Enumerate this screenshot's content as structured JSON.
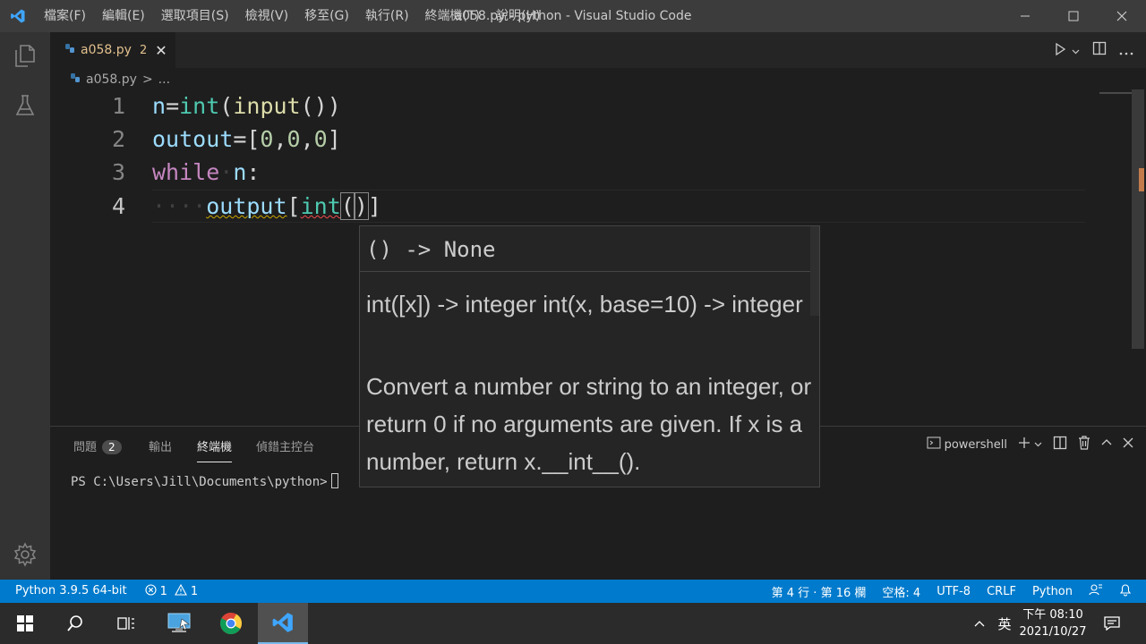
{
  "window": {
    "title": "a058.py - python - Visual Studio Code",
    "menu": [
      "檔案(F)",
      "編輯(E)",
      "選取項目(S)",
      "檢視(V)",
      "移至(G)",
      "執行(R)",
      "終端機(T)",
      "說明(H)"
    ]
  },
  "tab": {
    "filename": "a058.py",
    "problem_count": "2"
  },
  "breadcrumb": {
    "file": "a058.py",
    "sep": ">",
    "rest": "..."
  },
  "editor": {
    "line_numbers": [
      "1",
      "2",
      "3",
      "4"
    ],
    "line1": {
      "n": "n",
      "eq": "=",
      "int": "int",
      "p1": "(",
      "input": "input",
      "p2": "())"
    },
    "line2": {
      "var": "outout",
      "eq": "=[",
      "a": "0",
      "c1": ",",
      "b": "0",
      "c2": ",",
      "c": "0",
      "end": "]"
    },
    "line3": {
      "kw": "while",
      "sp": "·",
      "n": "n",
      "colon": ":"
    },
    "line4": {
      "indent": "····",
      "var": "output",
      "br": "[",
      "int": "int",
      "po": "(",
      "pc": ")",
      "end": "]"
    }
  },
  "hover": {
    "signature": "() -> None",
    "doc_signature": "int([x]) -> integer int(x, base=10) -> integer",
    "doc_text": "Convert a number or string to an integer, or return 0 if no arguments are given. If x is a number, return x.__int__()."
  },
  "panel": {
    "tabs": [
      "問題",
      "輸出",
      "終端機",
      "偵錯主控台"
    ],
    "problems_badge": "2",
    "active_tab": "終端機",
    "shell": "powershell",
    "terminal_prompt": "PS C:\\Users\\Jill\\Documents\\python>"
  },
  "statusbar": {
    "python": "Python 3.9.5 64-bit",
    "errors": "1",
    "warnings": "1",
    "position": "第 4 行 · 第 16 欄",
    "spaces": "空格: 4",
    "encoding": "UTF-8",
    "eol": "CRLF",
    "language": "Python"
  },
  "taskbar": {
    "ime": "英",
    "time": "下午 08:10",
    "date": "2021/10/27"
  },
  "colors": {
    "accent": "#007acc",
    "titlebar": "#3c3c3c",
    "editor_bg": "#1e1e1e"
  }
}
